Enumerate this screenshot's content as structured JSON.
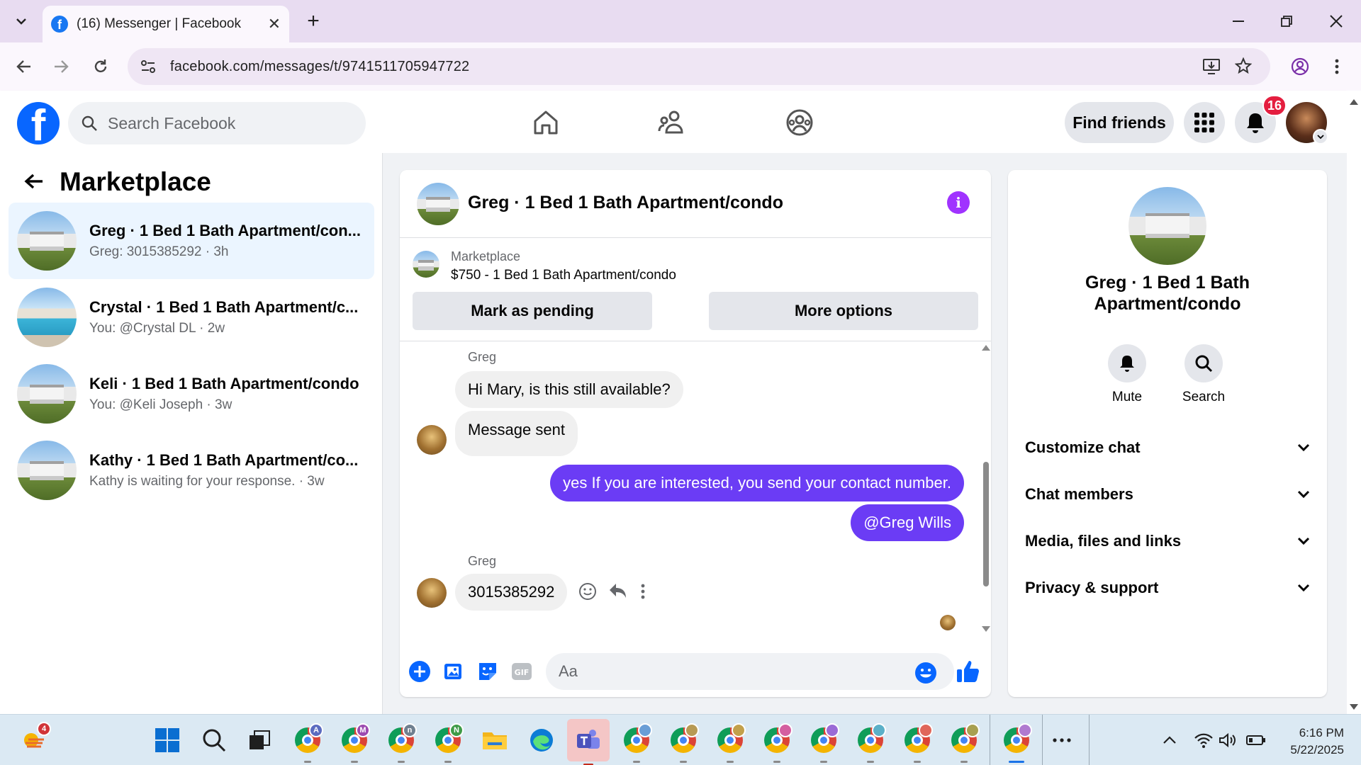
{
  "browser": {
    "tab_title": "(16) Messenger | Facebook",
    "url": "facebook.com/messages/t/9741511705947722",
    "new_tab_symbol": "+"
  },
  "fb": {
    "search_placeholder": "Search Facebook",
    "find_friends": "Find friends",
    "notification_count": "16",
    "brand_color": "#0866ff"
  },
  "left": {
    "title": "Marketplace",
    "conversations": [
      {
        "name": "Greg · 1 Bed 1 Bath Apartment/con...",
        "preview": "Greg: 3015385292 · 3h",
        "active": true
      },
      {
        "name": "Crystal · 1 Bed 1 Bath Apartment/c...",
        "preview": "You: @Crystal DL · 2w"
      },
      {
        "name": "Keli · 1 Bed 1 Bath Apartment/condo",
        "preview": "You: @Keli Joseph · 3w"
      },
      {
        "name": "Kathy · 1 Bed 1 Bath Apartment/co...",
        "preview": "Kathy is waiting for your response. · 3w"
      }
    ]
  },
  "chat": {
    "title": "Greg · 1 Bed 1 Bath Apartment/condo",
    "marketplace_label": "Marketplace",
    "listing": "$750 - 1 Bed 1 Bath Apartment/condo",
    "mark_pending": "Mark as pending",
    "more_options": "More options",
    "messages": [
      {
        "sender": "Greg",
        "text": "Hi Mary, is this still available?"
      },
      {
        "text": "Message sent"
      },
      {
        "text": "yes If you are interested, you send your contact number.",
        "outgoing": true
      },
      {
        "text": "@Greg Wills",
        "outgoing": true
      },
      {
        "sender": "Greg",
        "text": "3015385292"
      }
    ],
    "input_placeholder": "Aa",
    "accent_color": "#6b3cf5"
  },
  "right": {
    "name": "Greg · 1 Bed 1 Bath Apartment/condo",
    "mute": "Mute",
    "search": "Search",
    "sections": [
      "Customize chat",
      "Chat members",
      "Media, files and links",
      "Privacy & support"
    ]
  },
  "taskbar": {
    "widget_badge": "4",
    "time": "6:16 PM",
    "date": "5/22/2025",
    "profile_letters": [
      "A",
      "M",
      "n",
      "N"
    ]
  }
}
